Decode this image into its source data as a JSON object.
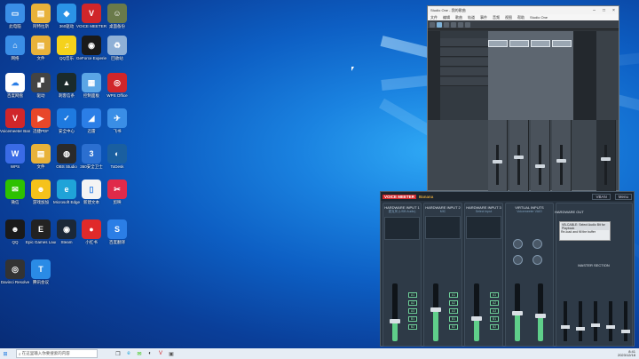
{
  "desktop": {
    "icons": [
      {
        "label": "此电脑",
        "color": "#3a8ee6",
        "glyph": "▭"
      },
      {
        "label": "阿特拉斯",
        "color": "#e8b23a",
        "glyph": "▤"
      },
      {
        "label": "360驱动",
        "color": "#2b93e6",
        "glyph": "◆"
      },
      {
        "label": "VOICE MEETER",
        "color": "#d0262a",
        "glyph": "V"
      },
      {
        "label": "桌面备份",
        "color": "#6a7a4a",
        "glyph": "☺"
      },
      {
        "label": "网络",
        "color": "#3a8ee6",
        "glyph": "⌂"
      },
      {
        "label": "文件",
        "color": "#e8b23a",
        "glyph": "▤"
      },
      {
        "label": "QQ音乐",
        "color": "#f5d21b",
        "glyph": "♫"
      },
      {
        "label": "GeForce Experience",
        "color": "#1a1a1a",
        "glyph": "◉"
      },
      {
        "label": "回收站",
        "color": "#8fb0d6",
        "glyph": "♻"
      },
      {
        "label": "百度网盘",
        "color": "#ffffff",
        "glyph": "☁"
      },
      {
        "label": "驱动",
        "color": "#444",
        "glyph": "▞"
      },
      {
        "label": "刺客信条",
        "color": "#1b2b2b",
        "glyph": "▲"
      },
      {
        "label": "控制面板",
        "color": "#5ba6e6",
        "glyph": "▦"
      },
      {
        "label": "WPS Office",
        "color": "#d0262a",
        "glyph": "◎"
      },
      {
        "label": "Voicemeeter Banana",
        "color": "#d0262a",
        "glyph": "V"
      },
      {
        "label": "迅捷PDF",
        "color": "#e8472a",
        "glyph": "▶"
      },
      {
        "label": "安全中心",
        "color": "#1e7ae0",
        "glyph": "✓"
      },
      {
        "label": "迅雷",
        "color": "#2b7ee6",
        "glyph": "◢"
      },
      {
        "label": "飞书",
        "color": "#3a8ee6",
        "glyph": "✈"
      },
      {
        "label": "WPS",
        "color": "#3a6be6",
        "glyph": "W"
      },
      {
        "label": "文件",
        "color": "#e8b23a",
        "glyph": "▤"
      },
      {
        "label": "OBS Studio",
        "color": "#2a2a2a",
        "glyph": "◍"
      },
      {
        "label": "360安全卫士",
        "color": "#2b6fd0",
        "glyph": "3"
      },
      {
        "label": "ToDesk",
        "color": "#1a5fa0",
        "glyph": "◐"
      },
      {
        "label": "微信",
        "color": "#2dc100",
        "glyph": "✉"
      },
      {
        "label": "游戏加加",
        "color": "#f5c21b",
        "glyph": "☻"
      },
      {
        "label": "Microsoft Edge",
        "color": "#1fa3d8",
        "glyph": "e"
      },
      {
        "label": "新建文本",
        "color": "#f4f4f4",
        "glyph": "▯"
      },
      {
        "label": "剪映",
        "color": "#e02a4a",
        "glyph": "✂"
      },
      {
        "label": "QQ",
        "color": "#1a1a1a",
        "glyph": "☻"
      },
      {
        "label": "Epic Games Launcher",
        "color": "#222",
        "glyph": "E"
      },
      {
        "label": "Steam",
        "color": "#1b2838",
        "glyph": "◉"
      },
      {
        "label": "小红书",
        "color": "#e02a2a",
        "glyph": "●"
      },
      {
        "label": "百度翻译",
        "color": "#2b7ee6",
        "glyph": "S"
      },
      {
        "label": "Davinci Resolve",
        "color": "#333",
        "glyph": "◎"
      },
      {
        "label": "腾讯会议",
        "color": "#2a8be6",
        "glyph": "T"
      }
    ]
  },
  "taskbar": {
    "search_placeholder": "在这里输入你要搜索的内容",
    "clock_time": "8:41",
    "clock_date": "2023/12/18"
  },
  "studio_one": {
    "title": "Studio One - 我的歌曲",
    "menu": [
      "文件",
      "编辑",
      "歌曲",
      "轨道",
      "事件",
      "音频",
      "视图",
      "帮助",
      "Studio One"
    ]
  },
  "voicemeeter": {
    "logo": "VOICE MEETER",
    "edition": "Banana",
    "menu_label": "Menu",
    "vban_label": "VBAN",
    "inputs": [
      {
        "title": "HARDWARE INPUT 1",
        "sub": "麦克风 (USB Audio)"
      },
      {
        "title": "HARDWARE INPUT 2",
        "sub": "MIC"
      },
      {
        "title": "HARDWARE INPUT 3",
        "sub": "Select Input"
      }
    ],
    "virtual_inputs": [
      {
        "title": "VIRTUAL INPUTS",
        "sub": "Voicemeeter VAIO"
      },
      {
        "title": "",
        "sub": "Voicemeeter AUX"
      }
    ],
    "hardware_out": "HARDWARE OUT",
    "dialog_title": "VB-CABLE: Select Audio Bit for Playback",
    "dialog_text": "Re-load and fill the buffer",
    "master_section": "MASTER SECTION",
    "bus_buttons": [
      "A1",
      "A2",
      "A3",
      "B1",
      "B2"
    ],
    "input_levels": [
      0.35,
      0.55,
      0.4
    ],
    "virtual_levels": [
      0.5,
      0.45
    ],
    "master_levels": [
      0.4,
      0.35,
      0.45,
      0.4,
      0.3
    ]
  }
}
